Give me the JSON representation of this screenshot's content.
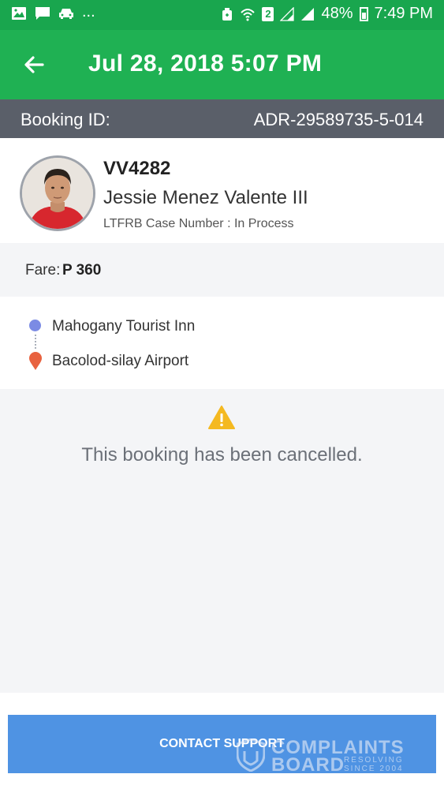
{
  "status_bar": {
    "sim_slot": "2",
    "battery": "48%",
    "time": "7:49 PM",
    "overflow": "..."
  },
  "header": {
    "title": "Jul 28, 2018 5:07 PM"
  },
  "booking": {
    "label": "Booking ID:",
    "id": "ADR-29589735-5-014"
  },
  "driver": {
    "plate": "VV4282",
    "name": "Jessie Menez Valente III",
    "ltfrb": "LTFRB Case Number : In Process"
  },
  "fare": {
    "label": "Fare:",
    "value": "P 360"
  },
  "route": {
    "pickup": "Mahogany Tourist Inn",
    "dropoff": "Bacolod-silay Airport"
  },
  "status": {
    "message": "This booking has been cancelled."
  },
  "footer": {
    "button": "CONTACT SUPPORT"
  },
  "watermark": {
    "line1": "COMPLAINTS",
    "line2": "BOARD",
    "tag1": "RESOLVING",
    "tag2": "SINCE 2004"
  },
  "colors": {
    "status_bar": "#19a64e",
    "app_bar": "#1fb153",
    "booking_bar": "#5a5f69",
    "pickup_dot": "#7b8be4",
    "dropoff_pin": "#e8623f",
    "warning": "#f4b921",
    "button": "#4f93e3"
  },
  "icons": {
    "back": "arrow-left-icon",
    "pickup": "pickup-dot-icon",
    "dropoff": "location-pin-icon",
    "warning": "warning-triangle-icon"
  }
}
